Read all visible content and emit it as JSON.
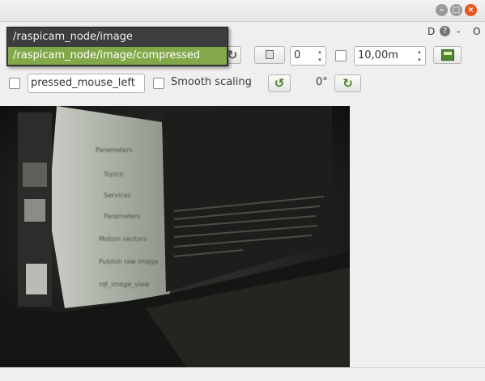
{
  "window": {
    "minimize_glyph": "–",
    "maximize_glyph": "□",
    "close_glyph": "×",
    "plugin_buttons": [
      "D",
      "?",
      "-",
      "O"
    ]
  },
  "topic_dropdown": {
    "options": [
      "/raspicam_node/image",
      "/raspicam_node/image/compressed"
    ],
    "selected_index": 1
  },
  "toolbar": {
    "refresh_icon": "refresh-icon",
    "fit_icon": "fit-window-icon",
    "zoom_value": "0",
    "spin_up": "▴",
    "spin_down": "▾",
    "max_range_value": "10,00m",
    "save_icon": "save-image-icon"
  },
  "toolbar2": {
    "mouse_topic_value": "pressed_mouse_left",
    "smooth_scaling_label": "Smooth scaling",
    "rotate_left_icon": "rotate-left-icon",
    "rotation_label": "0°",
    "rotate_right_icon": "rotate-right-icon"
  },
  "colors": {
    "accent": "#82a84a",
    "popup_bg": "#3d3d3d",
    "close_button": "#e95420"
  },
  "image_view": {
    "menu_items": [
      "Parameters",
      "Topics",
      "Services",
      "Parameters",
      "Motion vectors",
      "Publish raw image",
      "rqt_image_view"
    ]
  }
}
